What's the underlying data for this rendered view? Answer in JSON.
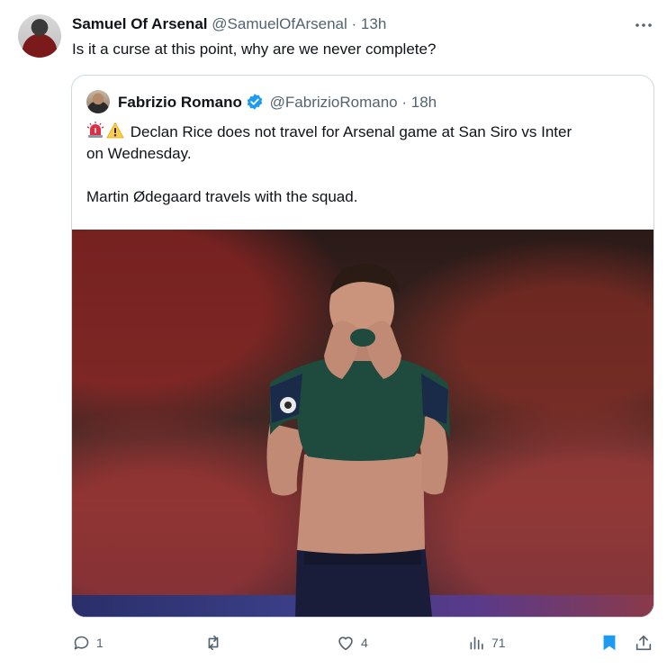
{
  "tweet": {
    "author_name": "Samuel Of Arsenal",
    "author_handle": "@SamuelOfArsenal",
    "separator": "·",
    "time": "13h",
    "text": "Is it a curse at this point, why are we never complete?"
  },
  "quote": {
    "author_name": "Fabrizio Romano",
    "author_handle": "@FabrizioRomano",
    "separator": "·",
    "time": "18h",
    "line1": "Declan Rice does not travel for Arsenal game at San Siro vs Inter",
    "line2": "on Wednesday.",
    "line3": "Martin Ødegaard travels with the squad."
  },
  "actions": {
    "reply_count": "1",
    "retweet_count": "",
    "like_count": "4",
    "views_count": "71"
  },
  "colors": {
    "text_primary": "#0f1419",
    "text_secondary": "#536471",
    "accent": "#1d9bf0",
    "border": "#cfd9de"
  },
  "icons": [
    "more-icon",
    "verified-icon",
    "rotating-light-icon",
    "warning-icon",
    "reply-icon",
    "retweet-icon",
    "like-icon",
    "views-icon",
    "bookmark-icon",
    "share-icon"
  ]
}
